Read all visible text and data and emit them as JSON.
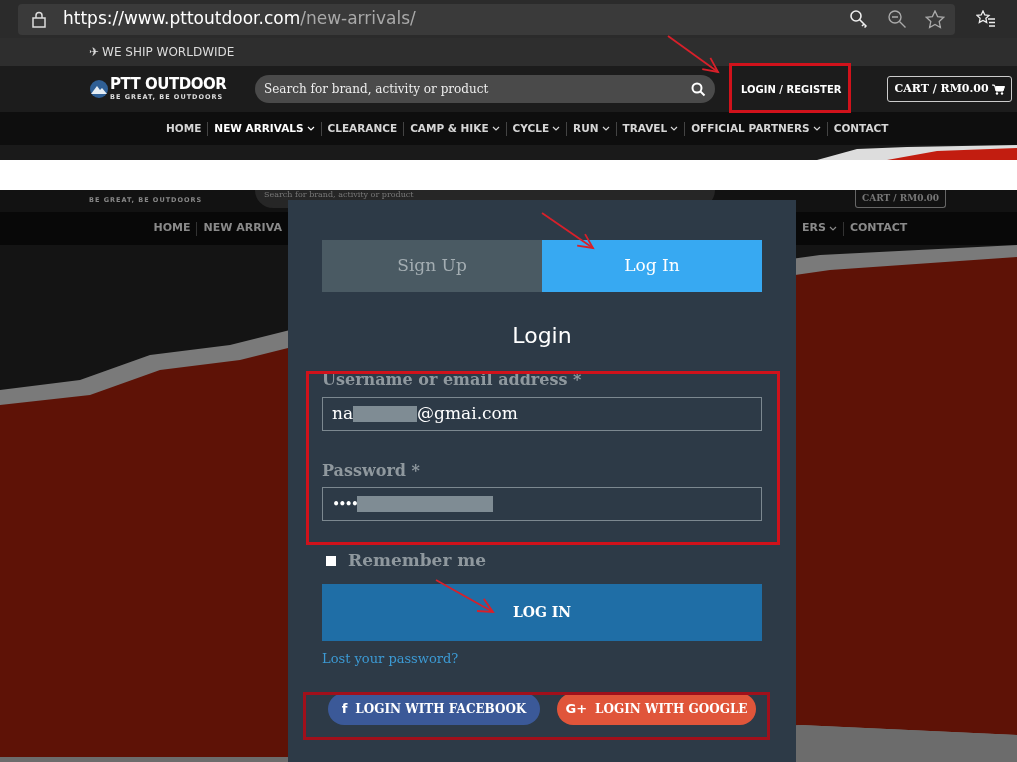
{
  "browser": {
    "url_host": "https://www.pttoutdoor.com",
    "url_path": "/new-arrivals/"
  },
  "top_bar": {
    "icon": "✈",
    "text": "WE SHIP WORLDWIDE"
  },
  "header": {
    "logo_name": "PTT OUTDOOR",
    "logo_tagline": "BE GREAT, BE OUTDOORS",
    "search_placeholder": "Search for brand, activity or product",
    "login_link": "LOGIN / REGISTER",
    "cart_button": "CART / RM0.00"
  },
  "nav": [
    {
      "label": "HOME",
      "has_menu": false,
      "selected": false
    },
    {
      "label": "NEW ARRIVALS",
      "has_menu": true,
      "selected": true
    },
    {
      "label": "CLEARANCE",
      "has_menu": false,
      "selected": false
    },
    {
      "label": "CAMP & HIKE",
      "has_menu": true,
      "selected": false
    },
    {
      "label": "CYCLE",
      "has_menu": true,
      "selected": false
    },
    {
      "label": "RUN",
      "has_menu": true,
      "selected": false
    },
    {
      "label": "TRAVEL",
      "has_menu": true,
      "selected": false
    },
    {
      "label": "OFFICIAL PARTNERS",
      "has_menu": true,
      "selected": false
    },
    {
      "label": "CONTACT",
      "has_menu": false,
      "selected": false
    }
  ],
  "background_page": {
    "logo_tagline": "BE GREAT, BE OUTDOORS",
    "search_placeholder": "Search for brand, activity or product",
    "cart_button": "CART / RM0.00",
    "nav_left": [
      {
        "label": "HOME",
        "has_menu": false
      },
      {
        "label": "NEW ARRIVA",
        "has_menu": false
      }
    ],
    "nav_right": [
      {
        "label": "ERS",
        "has_menu": true
      },
      {
        "label": "CONTACT",
        "has_menu": false
      }
    ]
  },
  "modal": {
    "tabs": [
      {
        "label": "Sign Up",
        "selected": false
      },
      {
        "label": "Log In",
        "selected": true
      }
    ],
    "title": "Login",
    "fields": [
      {
        "kind": "text",
        "label": "Username or email address *",
        "value_start": "na",
        "value_end": "@gmai.com",
        "redacted": true
      },
      {
        "kind": "password",
        "label": "Password *",
        "value_start": "••••",
        "redacted": true
      }
    ],
    "remember": {
      "label": "Remember me",
      "checked": false
    },
    "submit": "LOG IN",
    "lost_password": "Lost your password?",
    "social": [
      {
        "kind": "facebook",
        "icon": "f",
        "label": "LOGIN WITH FACEBOOK"
      },
      {
        "kind": "google",
        "icon": "G+",
        "label": "LOGIN WITH GOOGLE"
      }
    ]
  }
}
